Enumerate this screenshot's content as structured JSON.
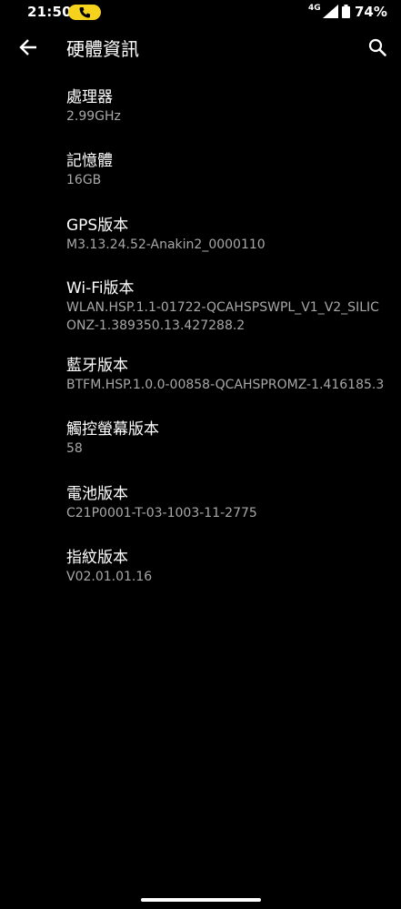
{
  "status_bar": {
    "time": "21:50",
    "network": "4G",
    "battery": "74%"
  },
  "app_bar": {
    "title": "硬體資訊"
  },
  "items": [
    {
      "title": "處理器",
      "value": "2.99GHz"
    },
    {
      "title": "記憶體",
      "value": "16GB"
    },
    {
      "title": "GPS版本",
      "value": "M3.13.24.52-Anakin2_0000110"
    },
    {
      "title": "Wi-Fi版本",
      "value": "WLAN.HSP.1.1-01722-QCAHSPSWPL_V1_V2_SILICONZ-1.389350.13.427288.2"
    },
    {
      "title": "藍牙版本",
      "value": "BTFM.HSP.1.0.0-00858-QCAHSPROMZ-1.416185.3"
    },
    {
      "title": "觸控螢幕版本",
      "value": "58"
    },
    {
      "title": "電池版本",
      "value": "C21P0001-T-03-1003-11-2775"
    },
    {
      "title": "指紋版本",
      "value": "V02.01.01.16"
    }
  ],
  "colors": {
    "background": "#000000",
    "primary_text": "#ffffff",
    "secondary_text": "#a8a8a8",
    "call_indicator": "#f5d21c"
  },
  "icons": {
    "back": "arrow-left-icon",
    "search": "search-icon",
    "call": "phone-icon",
    "signal": "signal-icon",
    "battery": "battery-icon"
  }
}
